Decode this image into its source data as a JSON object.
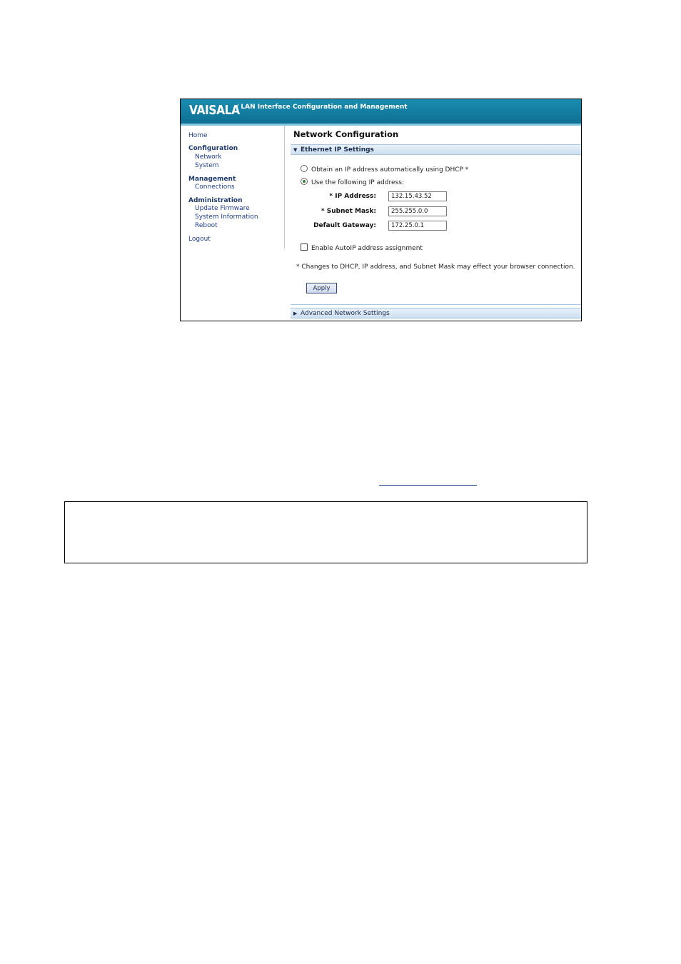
{
  "app": {
    "logo": "VAISALA",
    "title": "/ LAN Interface Configuration and Management"
  },
  "sidebar": {
    "home": "Home",
    "configuration": {
      "label": "Configuration",
      "items": [
        "Network",
        "System"
      ]
    },
    "management": {
      "label": "Management",
      "items": [
        "Connections"
      ]
    },
    "administration": {
      "label": "Administration",
      "items": [
        "Update Firmware",
        "System Information",
        "Reboot"
      ]
    },
    "logout": "Logout"
  },
  "main": {
    "page_title": "Network Configuration",
    "ethernet_section": "Ethernet IP Settings",
    "advanced_section": "Advanced Network Settings",
    "dhcp_option": "Obtain an IP address automatically using DHCP *",
    "static_option": "Use the following IP address:",
    "selected_option": "static",
    "fields": {
      "ip_label": "* IP Address:",
      "ip_value": "132.15.43.52",
      "subnet_label": "* Subnet Mask:",
      "subnet_value": "255.255.0.0",
      "gateway_label": "Default Gateway:",
      "gateway_value": "172.25.0.1"
    },
    "autoip_label": "Enable AutoIP address assignment",
    "autoip_checked": false,
    "note": "* Changes to DHCP, IP address, and Subnet Mask may effect your browser connection.",
    "apply_label": "Apply"
  },
  "colors": {
    "banner": "#1a8db0",
    "link": "#1f3e8a",
    "section_bar": "#cddff0"
  }
}
